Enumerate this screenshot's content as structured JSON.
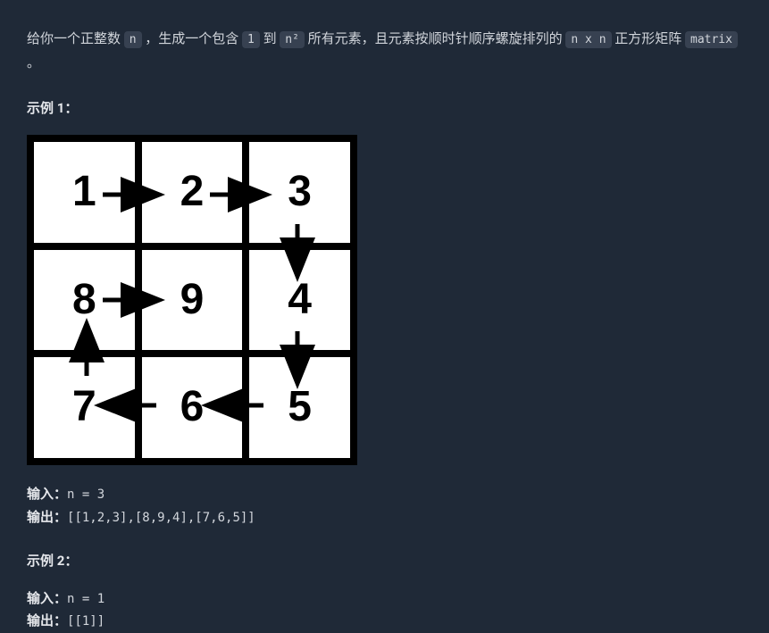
{
  "description": {
    "part1": "给你一个正整数 ",
    "code1": "n",
    "part2": " ，生成一个包含 ",
    "code2": "1",
    "part3": " 到 ",
    "code3": "n²",
    "part4": " 所有元素，且元素按顺时针顺序螺旋排列的 ",
    "code4": "n x n",
    "part5": " 正方形矩阵 ",
    "code5": "matrix",
    "part6": " 。"
  },
  "example1": {
    "title": "示例 1：",
    "input_label": "输入：",
    "input_value": "n = 3",
    "output_label": "输出：",
    "output_value": "[[1,2,3],[8,9,4],[7,6,5]]",
    "matrix_values": [
      "1",
      "2",
      "3",
      "8",
      "9",
      "4",
      "7",
      "6",
      "5"
    ]
  },
  "example2": {
    "title": "示例 2：",
    "input_label": "输入：",
    "input_value": "n = 1",
    "output_label": "输出：",
    "output_value": "[[1]]"
  }
}
